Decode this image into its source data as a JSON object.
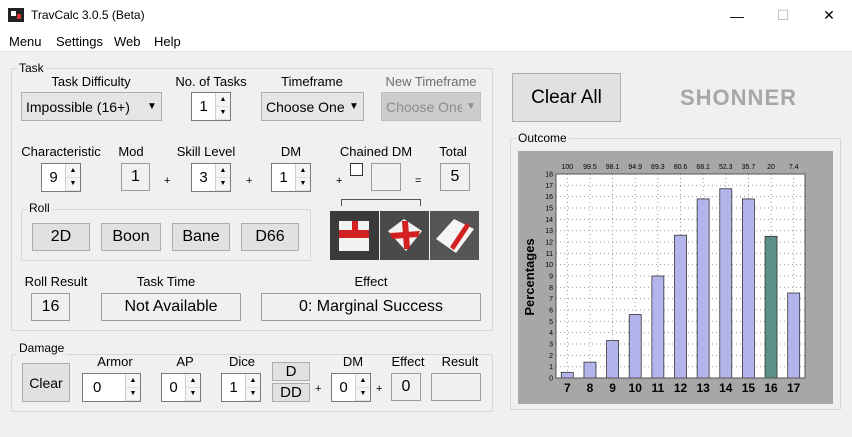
{
  "window": {
    "title": "TravCalc 3.0.5 (Beta)",
    "controls": {
      "minimize": "—",
      "maximize": "☐",
      "close": "✕"
    }
  },
  "menu": [
    "Menu",
    "Settings",
    "Web",
    "Help"
  ],
  "task": {
    "group_label": "Task",
    "difficulty_label": "Task Difficulty",
    "difficulty_value": "Impossible (16+)",
    "num_tasks_label": "No. of Tasks",
    "num_tasks_value": "1",
    "timeframe_label": "Timeframe",
    "timeframe_value": "Choose One",
    "new_timeframe_label": "New Timeframe",
    "new_timeframe_value": "Choose One",
    "characteristic_label": "Characteristic",
    "characteristic_value": "9",
    "mod_label": "Mod",
    "mod_value": "1",
    "skill_label": "Skill Level",
    "skill_value": "3",
    "dm_label": "DM",
    "dm_value": "1",
    "chained_dm_label": "Chained DM",
    "chained_dm_value": "",
    "total_label": "Total",
    "total_value": "5",
    "plus": "+",
    "equals": "=",
    "roll_group_label": "Roll",
    "roll_buttons": [
      "2D",
      "Boon",
      "Bane",
      "D66"
    ],
    "roll_result_label": "Roll Result",
    "roll_result_value": "16",
    "task_time_label": "Task Time",
    "task_time_value": "Not Available",
    "effect_label": "Effect",
    "effect_value": "0: Marginal Success"
  },
  "clear_all_label": "Clear All",
  "logo_text": "SHONNER",
  "damage": {
    "group_label": "Damage",
    "clear_label": "Clear",
    "armor_label": "Armor",
    "armor_value": "0",
    "ap_label": "AP",
    "ap_value": "0",
    "dice_label": "Dice",
    "dice_value": "1",
    "d_label": "D",
    "dd_label": "DD",
    "dm_label": "DM",
    "dm_value": "0",
    "effect_label": "Effect",
    "effect_value": "0",
    "result_label": "Result",
    "result_value": "",
    "plus": "+"
  },
  "outcome": {
    "group_label": "Outcome"
  },
  "chart_data": {
    "type": "bar",
    "categories": [
      "7",
      "8",
      "9",
      "10",
      "11",
      "12",
      "13",
      "14",
      "15",
      "16",
      "17"
    ],
    "values": [
      0.5,
      1.4,
      3.3,
      5.6,
      9,
      12.6,
      15.8,
      16.7,
      15.8,
      12.5,
      7.5
    ],
    "top_labels": [
      "100",
      "99.5",
      "98.1",
      "94.9",
      "89.3",
      "80.6",
      "68.1",
      "52.3",
      "35.7",
      "20",
      "7.4"
    ],
    "ylabel": "Percentages",
    "ylim": [
      0,
      18
    ],
    "yticks": [
      "0",
      "1",
      "2",
      "3",
      "4",
      "5",
      "6",
      "7",
      "8",
      "9",
      "10",
      "11",
      "12",
      "13",
      "14",
      "15",
      "16",
      "17",
      "18"
    ],
    "highlight_index": 9,
    "bar_color": "#b4b4ec",
    "highlight_color": "#5a9085",
    "grid": true
  }
}
